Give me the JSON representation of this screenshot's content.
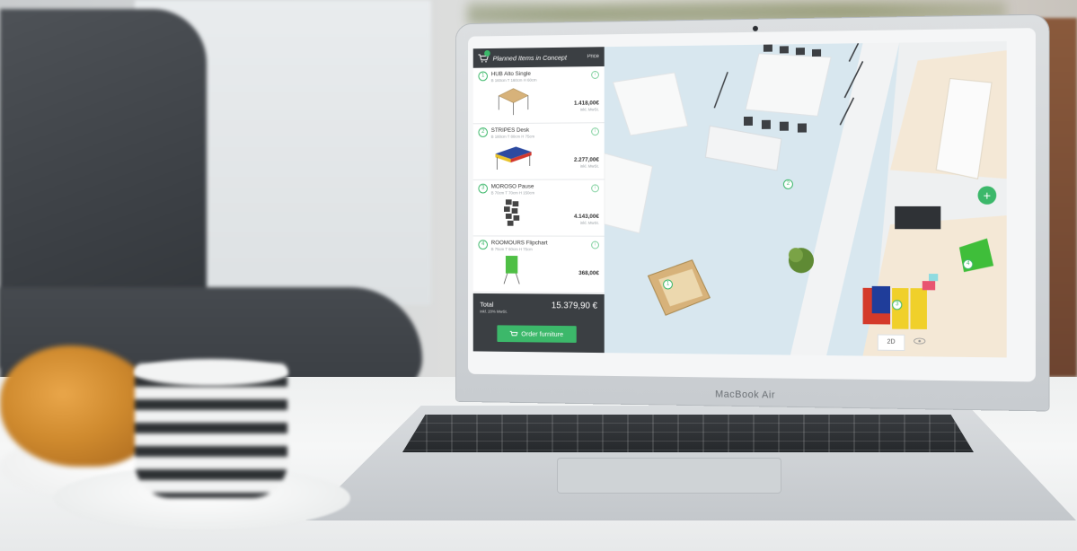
{
  "sidebar": {
    "header_title": "Planned Items in Concept",
    "header_price": "Price",
    "items": [
      {
        "num": "1",
        "name": "HUB Alto Single",
        "dims": "B 160cm T 160cm H 60cm",
        "price": "1.418,00€",
        "vat": "inkl. MwSt."
      },
      {
        "num": "2",
        "name": "STRIPES Desk",
        "dims": "B 180cm T 80cm H 75cm",
        "price": "2.277,00€",
        "vat": "inkl. MwSt."
      },
      {
        "num": "3",
        "name": "MOROSO Pause",
        "dims": "B 70cm T 70cm H 150cm",
        "price": "4.143,00€",
        "vat": "inkl. MwSt."
      },
      {
        "num": "4",
        "name": "ROOMOURS Flipchart",
        "dims": "B 75cm T 60cm H 75cm",
        "price": "368,00€",
        "vat": ""
      }
    ],
    "total_label": "Total",
    "total_sub": "inkl. 20% MwSt.",
    "total_value": "15.379,90 €",
    "order_button": "Order furniture"
  },
  "plan": {
    "view_2d": "2D",
    "add_button": "+",
    "markers": [
      "1",
      "2",
      "3",
      "4"
    ]
  },
  "laptop": {
    "brand": "MacBook Air"
  },
  "colors": {
    "accent": "#3cb86a",
    "sidebar_dark": "#3b3f43",
    "floor": "#d8e7ef"
  }
}
